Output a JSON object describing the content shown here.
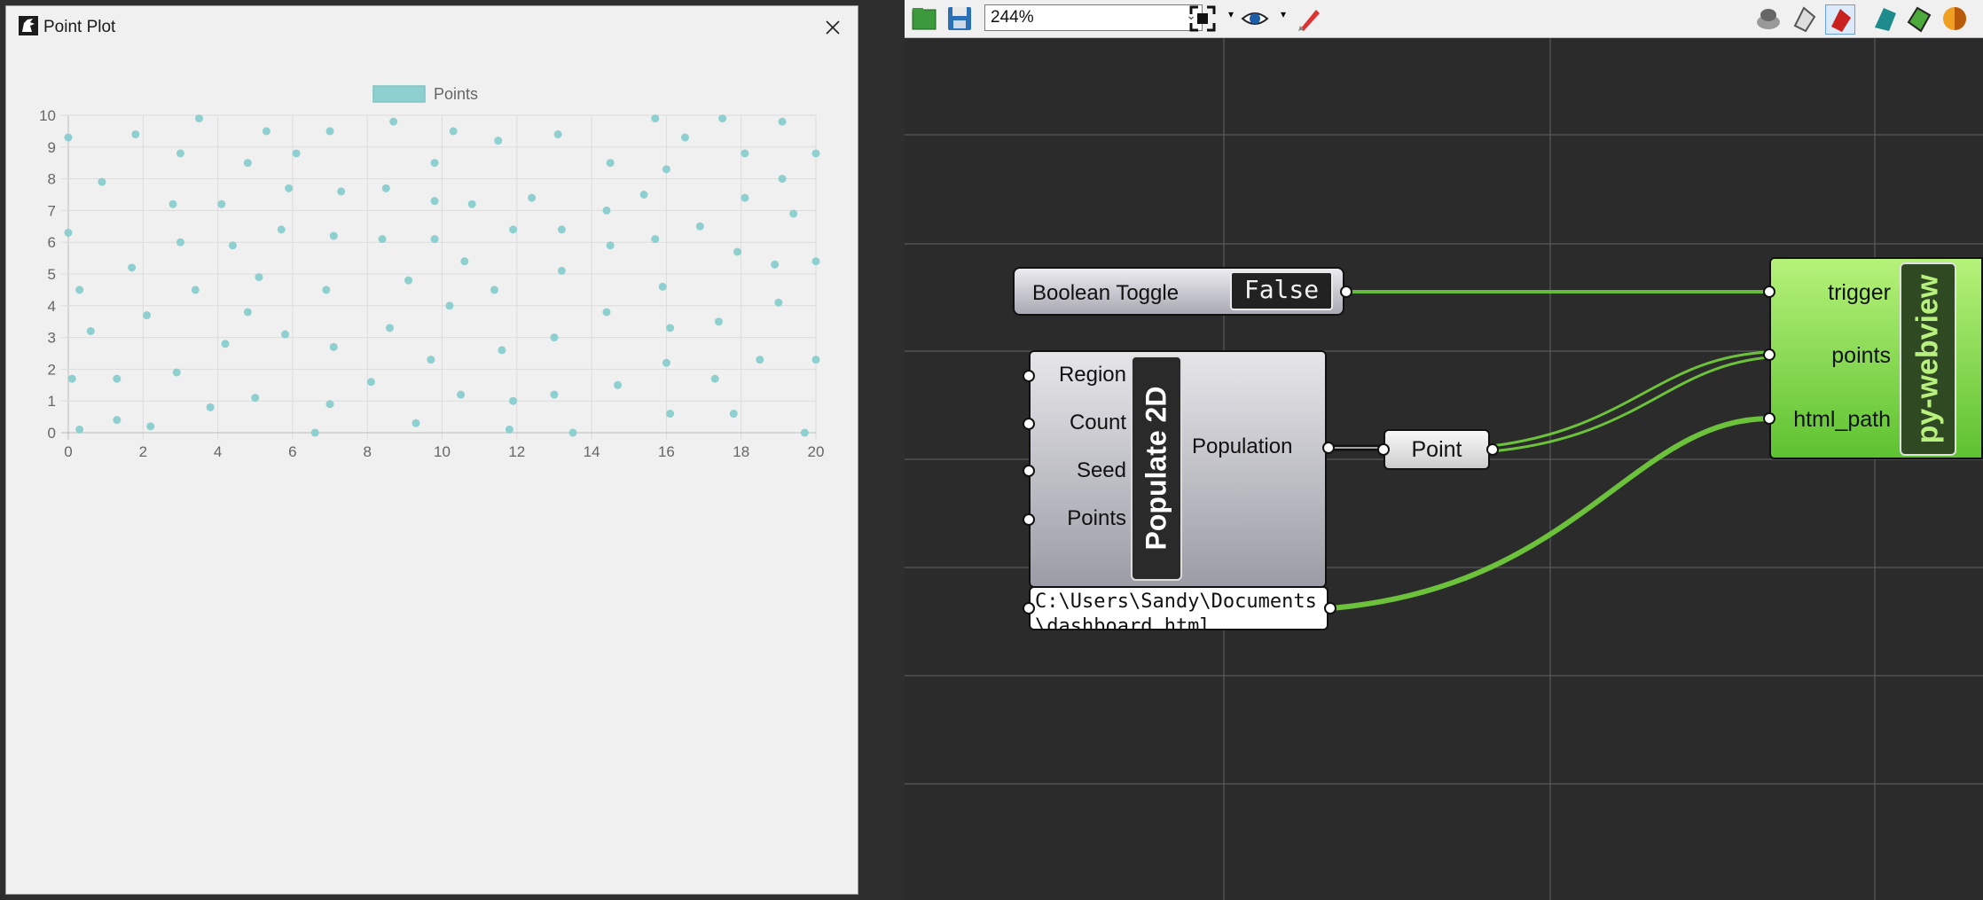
{
  "webview": {
    "title": "Point Plot",
    "close_icon": "close-icon"
  },
  "chart_data": {
    "type": "scatter",
    "legend": "top-center",
    "series": [
      {
        "name": "Points",
        "color": "#8ecfcf",
        "points": [
          [
            0,
            9.3
          ],
          [
            0,
            6.3
          ],
          [
            0.1,
            1.7
          ],
          [
            0.3,
            4.5
          ],
          [
            0.3,
            0.1
          ],
          [
            0.6,
            3.2
          ],
          [
            0.9,
            7.9
          ],
          [
            1.3,
            0.4
          ],
          [
            1.3,
            1.7
          ],
          [
            1.7,
            5.2
          ],
          [
            1.8,
            9.4
          ],
          [
            2.1,
            3.7
          ],
          [
            2.2,
            0.2
          ],
          [
            2.8,
            7.2
          ],
          [
            2.9,
            1.9
          ],
          [
            3.0,
            8.8
          ],
          [
            3.0,
            6.0
          ],
          [
            3.4,
            4.5
          ],
          [
            3.5,
            9.9
          ],
          [
            3.8,
            0.8
          ],
          [
            4.1,
            7.2
          ],
          [
            4.2,
            2.8
          ],
          [
            4.4,
            5.9
          ],
          [
            4.8,
            3.8
          ],
          [
            4.8,
            8.5
          ],
          [
            5.0,
            1.1
          ],
          [
            5.1,
            4.9
          ],
          [
            5.3,
            9.5
          ],
          [
            5.7,
            6.4
          ],
          [
            5.8,
            3.1
          ],
          [
            5.9,
            7.7
          ],
          [
            6.1,
            8.8
          ],
          [
            6.6,
            0
          ],
          [
            6.9,
            4.5
          ],
          [
            7.0,
            9.5
          ],
          [
            7.0,
            0.9
          ],
          [
            7.1,
            6.2
          ],
          [
            7.1,
            2.7
          ],
          [
            7.3,
            7.6
          ],
          [
            8.1,
            1.6
          ],
          [
            8.4,
            6.1
          ],
          [
            8.5,
            7.7
          ],
          [
            8.6,
            3.3
          ],
          [
            8.7,
            9.8
          ],
          [
            9.1,
            4.8
          ],
          [
            9.3,
            0.3
          ],
          [
            9.7,
            2.3
          ],
          [
            9.8,
            8.5
          ],
          [
            9.8,
            7.3
          ],
          [
            9.8,
            6.1
          ],
          [
            10.2,
            4.0
          ],
          [
            10.3,
            9.5
          ],
          [
            10.5,
            1.2
          ],
          [
            10.6,
            5.4
          ],
          [
            10.8,
            7.2
          ],
          [
            11.4,
            4.5
          ],
          [
            11.5,
            9.2
          ],
          [
            11.6,
            2.6
          ],
          [
            11.8,
            0.1
          ],
          [
            11.9,
            1.0
          ],
          [
            11.9,
            6.4
          ],
          [
            12.4,
            7.4
          ],
          [
            13.0,
            3.0
          ],
          [
            13.0,
            1.2
          ],
          [
            13.1,
            9.4
          ],
          [
            13.2,
            6.4
          ],
          [
            13.2,
            5.1
          ],
          [
            13.5,
            0
          ],
          [
            14.4,
            7.0
          ],
          [
            14.4,
            3.8
          ],
          [
            14.5,
            5.9
          ],
          [
            14.5,
            8.5
          ],
          [
            14.7,
            1.5
          ],
          [
            15.4,
            7.5
          ],
          [
            15.7,
            9.9
          ],
          [
            15.7,
            6.1
          ],
          [
            15.9,
            4.6
          ],
          [
            16.0,
            8.3
          ],
          [
            16.0,
            2.2
          ],
          [
            16.1,
            0.6
          ],
          [
            16.1,
            3.3
          ],
          [
            16.5,
            9.3
          ],
          [
            16.9,
            6.5
          ],
          [
            17.3,
            1.7
          ],
          [
            17.4,
            3.5
          ],
          [
            17.5,
            9.9
          ],
          [
            17.8,
            0.6
          ],
          [
            17.9,
            5.7
          ],
          [
            18.1,
            7.4
          ],
          [
            18.1,
            8.8
          ],
          [
            18.5,
            2.3
          ],
          [
            18.9,
            5.3
          ],
          [
            19.0,
            4.1
          ],
          [
            19.1,
            8.0
          ],
          [
            19.1,
            9.8
          ],
          [
            19.4,
            6.9
          ],
          [
            19.7,
            0
          ],
          [
            20.0,
            8.8
          ],
          [
            20.0,
            5.4
          ],
          [
            20.0,
            2.3
          ]
        ]
      }
    ],
    "xlim": [
      0,
      20
    ],
    "ylim": [
      0,
      10
    ],
    "x_ticks": [
      "0",
      "2",
      "4",
      "6",
      "8",
      "10",
      "12",
      "14",
      "16",
      "18",
      "20"
    ],
    "y_ticks": [
      "0",
      "1",
      "2",
      "3",
      "4",
      "5",
      "6",
      "7",
      "8",
      "9",
      "10"
    ],
    "grid": true
  },
  "toolbar": {
    "zoom": "244%",
    "icons": [
      "open-file-icon",
      "save-file-icon",
      "zoom-extents-icon",
      "preview-eye-icon",
      "sketch-pen-icon",
      "preview-off-icon",
      "preview-wire-icon",
      "preview-shaded-icon",
      "bake-icon",
      "preview-mesh-icon",
      "material-sphere-icon"
    ]
  },
  "canvas": {
    "boolean_toggle": {
      "label": "Boolean Toggle",
      "value": "False"
    },
    "populate": {
      "name": "Populate 2D",
      "inputs": [
        "Region",
        "Count",
        "Seed",
        "Points"
      ],
      "output": "Population"
    },
    "point_param": {
      "label": "Point"
    },
    "panel": {
      "text": "C:\\Users\\Sandy\\Documents\\dashboard.html"
    },
    "webview": {
      "name": "py-webview",
      "inputs": [
        "trigger",
        "points",
        "html_path"
      ]
    }
  }
}
